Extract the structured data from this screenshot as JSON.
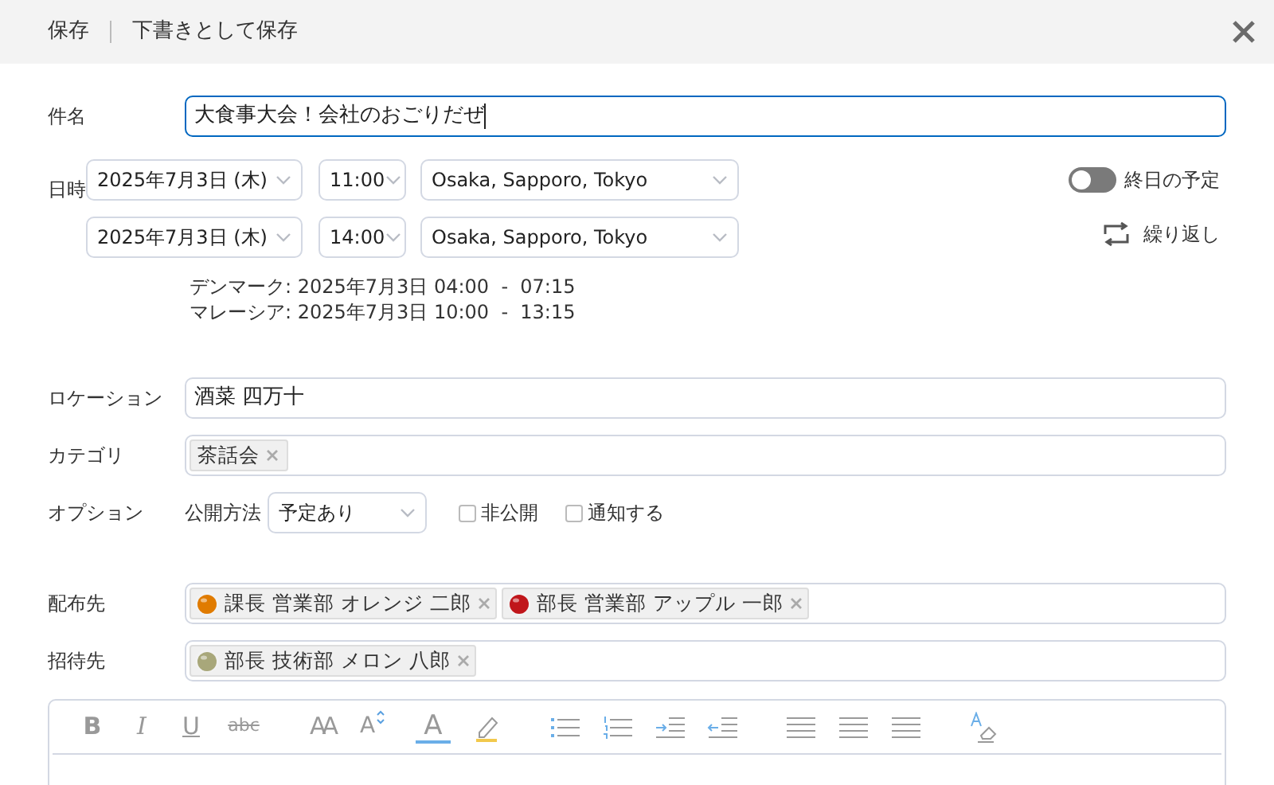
{
  "header": {
    "save": "保存",
    "save_draft": "下書きとして保存"
  },
  "subject": {
    "label": "件名",
    "value": "大食事大会！会社のおごりだぜ"
  },
  "datetime": {
    "label": "日時",
    "rows": [
      {
        "date": "2025年7月3日 (木)",
        "time": "11:00",
        "timezone": "Osaka, Sapporo, Tokyo"
      },
      {
        "date": "2025年7月3日 (木)",
        "time": "14:00",
        "timezone": "Osaka, Sapporo, Tokyo"
      }
    ],
    "all_day": {
      "label": "終日の予定",
      "on": false
    },
    "repeat": {
      "label": "繰り返し"
    },
    "other_zones": [
      "デンマーク: 2025年7月3日 04:00  -  07:15",
      "マレーシア: 2025年7月3日 10:00  -  13:15"
    ]
  },
  "location": {
    "label": "ロケーション",
    "value": "酒菜 四万十"
  },
  "category": {
    "label": "カテゴリ",
    "tags": [
      "茶話会"
    ]
  },
  "options": {
    "label": "オプション",
    "publish_label": "公開方法",
    "publish_value": "予定あり",
    "checks": [
      {
        "label": "非公開",
        "checked": false
      },
      {
        "label": "通知する",
        "checked": false
      }
    ]
  },
  "distribution": {
    "label": "配布先",
    "people": [
      {
        "name": "課長 営業部 オレンジ 二郎",
        "color": "#e07b00"
      },
      {
        "name": "部長 営業部 アップル 一郎",
        "color": "#c0161b"
      }
    ]
  },
  "invitees": {
    "label": "招待先",
    "people": [
      {
        "name": "部長 技術部 メロン 八郎",
        "color": "#a8a77a"
      }
    ]
  },
  "toolbar": [
    {
      "kind": "bold",
      "label": "B"
    },
    {
      "kind": "italic",
      "label": "I"
    },
    {
      "kind": "underline",
      "label": "U"
    },
    {
      "kind": "strike",
      "label": "abc"
    },
    {
      "kind": "font-size",
      "label": "AA"
    },
    {
      "kind": "grow",
      "label": "A"
    },
    {
      "kind": "color",
      "label": "A"
    },
    {
      "kind": "highlight"
    },
    {
      "kind": "bullets"
    },
    {
      "kind": "numbers"
    },
    {
      "kind": "indent"
    },
    {
      "kind": "outdent"
    },
    {
      "kind": "align-left"
    },
    {
      "kind": "align-center"
    },
    {
      "kind": "align-right"
    },
    {
      "kind": "clear"
    }
  ]
}
